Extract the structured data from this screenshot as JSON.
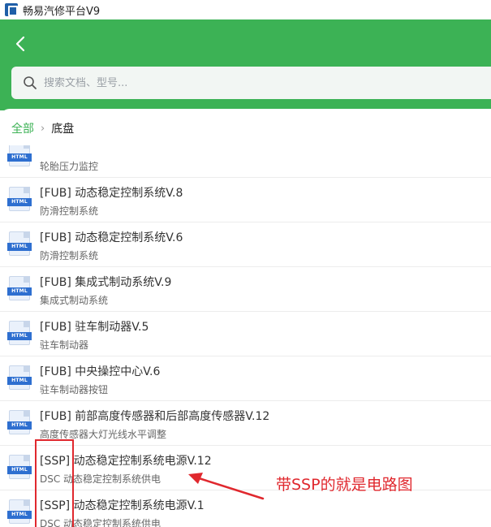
{
  "window": {
    "title": "畅易汽修平台V9"
  },
  "search": {
    "placeholder": "搜索文档、型号..."
  },
  "breadcrumb": {
    "root": "全部",
    "separator": "›",
    "current": "底盘"
  },
  "file_tag": "HTML",
  "items": [
    {
      "title": "",
      "subtitle": "轮胎压力监控"
    },
    {
      "title": "[FUB] 动态稳定控制系统V.8",
      "subtitle": "防滑控制系统"
    },
    {
      "title": "[FUB] 动态稳定控制系统V.6",
      "subtitle": "防滑控制系统"
    },
    {
      "title": "[FUB] 集成式制动系统V.9",
      "subtitle": "集成式制动系统"
    },
    {
      "title": "[FUB] 驻车制动器V.5",
      "subtitle": "驻车制动器"
    },
    {
      "title": "[FUB] 中央操控中心V.6",
      "subtitle": "驻车制动器按钮"
    },
    {
      "title": "[FUB] 前部高度传感器和后部高度传感器V.12",
      "subtitle": "高度传感器大灯光线水平调整"
    },
    {
      "title": "[SSP] 动态稳定控制系统电源V.12",
      "subtitle": "DSC 动态稳定控制系统供电"
    },
    {
      "title": "[SSP] 动态稳定控制系统电源V.1",
      "subtitle": "DSC 动态稳定控制系统供电"
    }
  ],
  "annotation": {
    "text": "带SSP的就是电路图",
    "color": "#e0282e"
  },
  "colors": {
    "header": "#3cb255",
    "accent": "#3cb255",
    "file_tag": "#2e6fd0"
  }
}
